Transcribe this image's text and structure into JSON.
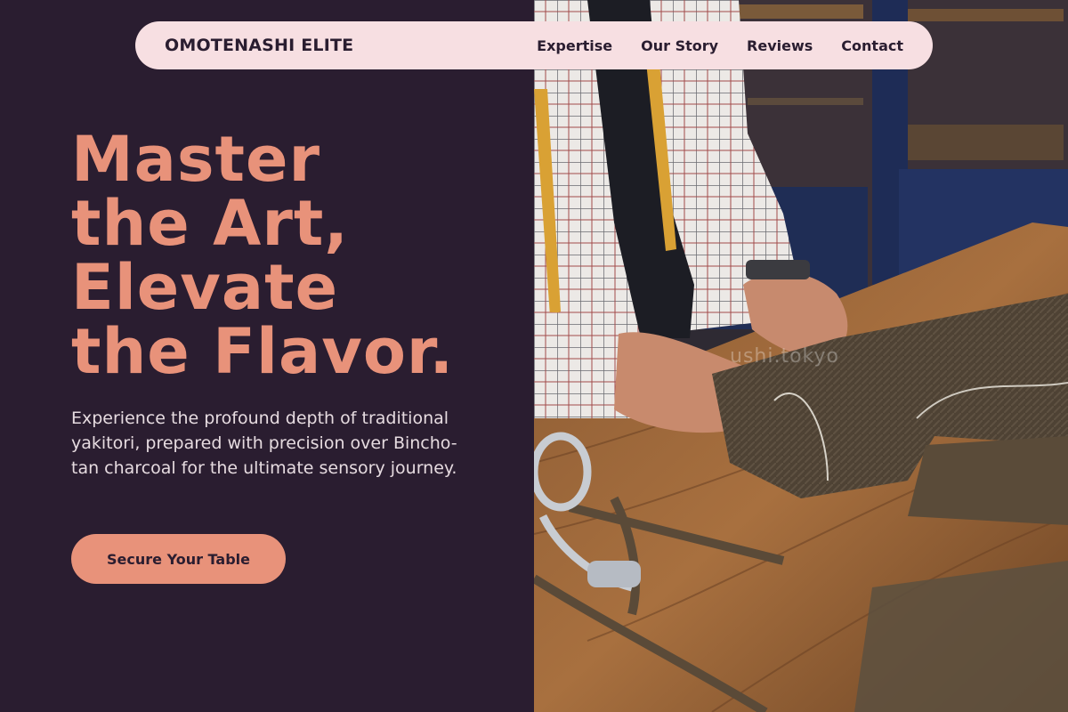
{
  "nav": {
    "brand": "OMOTENASHI ELITE",
    "links": [
      "Expertise",
      "Our Story",
      "Reviews",
      "Contact"
    ]
  },
  "hero": {
    "headline_lines": [
      "Master",
      "the Art,",
      "Elevate",
      "the Flavor."
    ],
    "description": "Experience the profound depth of traditional yakitori, prepared with precision over Bincho-tan charcoal for the ultimate sensory journey.",
    "cta_label": "Secure Your Table"
  },
  "image": {
    "watermark": "ushi.tokyo",
    "subject": "tailor-cutting-tweed-fabric"
  },
  "colors": {
    "background": "#2a1d30",
    "accent": "#e8927a",
    "nav_background": "#f7dfe2",
    "text_light": "#e6dbe0"
  }
}
